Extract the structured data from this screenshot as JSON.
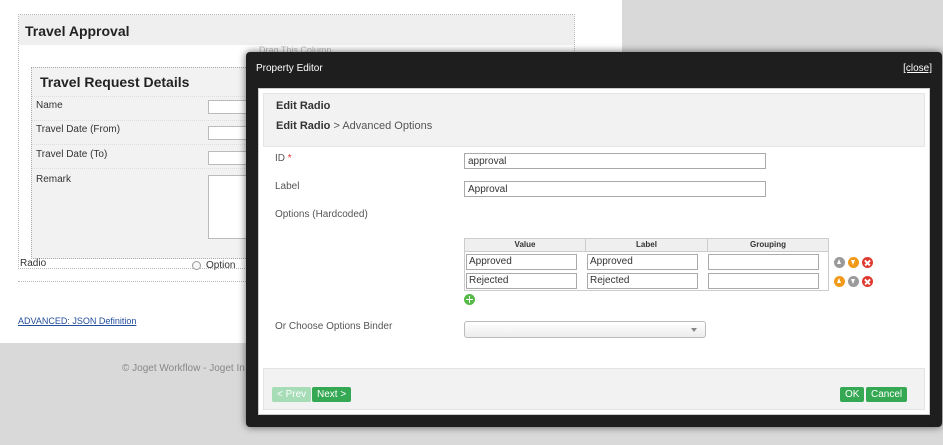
{
  "form": {
    "title": "Travel Approval",
    "drag_hint": "Drag This Column",
    "section_title": "Travel Request Details",
    "fields": [
      {
        "label": "Name"
      },
      {
        "label": "Travel Date (From)"
      },
      {
        "label": "Travel Date (To)"
      },
      {
        "label": "Remark"
      }
    ],
    "radio_label": "Radio",
    "radio_option": "Option",
    "advanced_link": "ADVANCED: JSON Definition"
  },
  "footer": {
    "copyright": "© Joget Workflow - Joget In"
  },
  "modal": {
    "title": "Property Editor",
    "close_label": "[close]",
    "edit_title": "Edit Radio",
    "breadcrumb": {
      "current": "Edit Radio",
      "separator": " > ",
      "next": "Advanced Options"
    },
    "id": {
      "label": "ID",
      "required_mark": "*",
      "value": "approval"
    },
    "label_field": {
      "label": "Label",
      "value": "Approval"
    },
    "options": {
      "label": "Options (Hardcoded)",
      "headers": [
        "Value",
        "Label",
        "Grouping"
      ],
      "rows": [
        {
          "value": "Approved",
          "label": "Approved",
          "grouping": ""
        },
        {
          "value": "Rejected",
          "label": "Rejected",
          "grouping": ""
        }
      ]
    },
    "binder": {
      "label": "Or Choose Options Binder",
      "selected": ""
    },
    "buttons": {
      "prev": "< Prev",
      "next": "Next >",
      "ok": "OK",
      "cancel": "Cancel"
    }
  },
  "colors": {
    "accent_green": "#34a853",
    "icon_orange": "#f19a1a",
    "icon_red": "#e0392f",
    "icon_grey": "#9a9a9a"
  }
}
